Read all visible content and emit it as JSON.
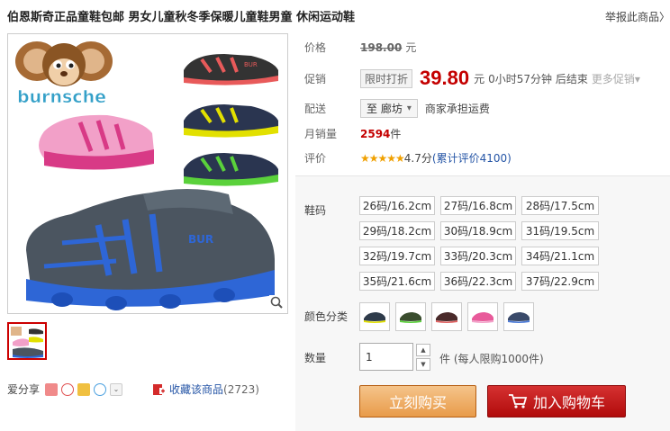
{
  "title": "伯恩斯奇正品童鞋包邮 男女儿童秋冬季保暖儿童鞋男童 休闲运动鞋",
  "report": "举报此商品",
  "report_arrow": "〉",
  "brand_logo_text": "burnsche",
  "shoe_brand": "BUR",
  "price": {
    "label": "价格",
    "original": "198.00",
    "unit": "元"
  },
  "promo": {
    "label": "促销",
    "tag": "限时打折",
    "price": "39.80",
    "unit": "元",
    "countdown": "0小时57分钟 后结束",
    "more": "更多促销",
    "more_arrow": "▾"
  },
  "shipping": {
    "label": "配送",
    "to": "至 廊坊",
    "arrow": "▾",
    "note": "商家承担运费"
  },
  "monthly_sales": {
    "label": "月销量",
    "value": "2594",
    "unit": "件"
  },
  "review": {
    "label": "评价",
    "stars": "★★★★★",
    "score": "4.7分",
    "link": "(累计评价4100)"
  },
  "sizes": {
    "label": "鞋码",
    "items": [
      "26码/16.2cm",
      "27码/16.8cm",
      "28码/17.5cm",
      "29码/18.2cm",
      "30码/18.9cm",
      "31码/19.5cm",
      "32码/19.7cm",
      "33码/20.3cm",
      "34码/21.1cm",
      "35码/21.6cm",
      "36码/22.3cm",
      "37码/22.9cm"
    ]
  },
  "colors": {
    "label": "颜色分类",
    "swatches": [
      "#2e3b4a",
      "#3a4d2e",
      "#4a2a2a",
      "#e85a9a",
      "#3a4a6a"
    ],
    "accents": [
      "#e2e000",
      "#5ad13b",
      "#e06060",
      "#f2a0c8",
      "#4a7ad8"
    ]
  },
  "quantity": {
    "label": "数量",
    "value": "1",
    "note": "件 (每人限购1000件)",
    "up": "▲",
    "down": "▼"
  },
  "buttons": {
    "buy": "立刻购买",
    "cart": "加入购物车"
  },
  "share": {
    "label": "爱分享"
  },
  "favorite": {
    "label": "收藏该商品",
    "count": "(2723)"
  },
  "colors_ui": {
    "price_red": "#c40000",
    "link_blue": "#2555a6"
  }
}
